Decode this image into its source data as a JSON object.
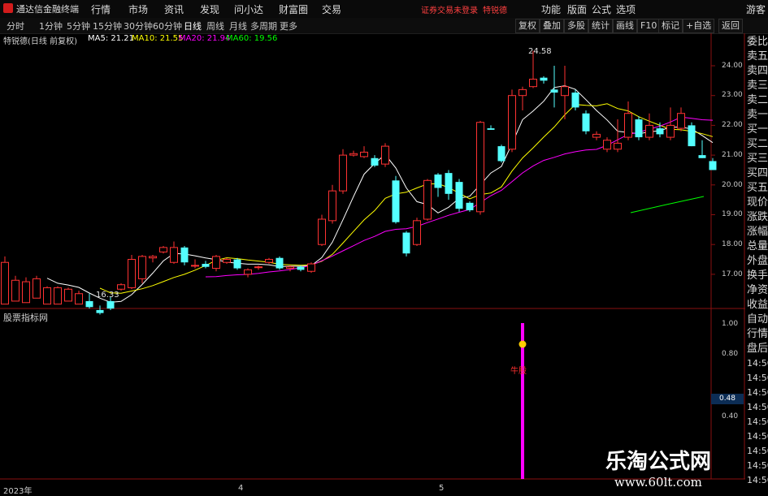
{
  "titlebar": {
    "app": "通达信金融终端",
    "menus": [
      "行情",
      "市场",
      "资讯",
      "发现",
      "问小达",
      "财富圈",
      "交易"
    ],
    "warning": "证券交易未登录",
    "user": "特锐德",
    "right": [
      "功能",
      "版面",
      "公式",
      "选项"
    ],
    "right2": "游客"
  },
  "periods": [
    "分时",
    "1分钟",
    "5分钟",
    "15分钟",
    "30分钟",
    "60分钟",
    "日线",
    "周线",
    "月线",
    "多周期",
    "更多"
  ],
  "active_period": "日线",
  "tools": [
    "复权",
    "叠加",
    "多股",
    "统计",
    "画线",
    "F10",
    "标记",
    "+自选",
    "返回"
  ],
  "stock": {
    "name": "特锐德(日线 前复权)",
    "ma5": "MA5: 21.21",
    "ma10": "MA10: 21.55",
    "ma20": "MA20: 21.94",
    "ma60": "MA60: 19.56"
  },
  "quote_labels": [
    "委比",
    "卖五",
    "卖四",
    "卖三",
    "卖二",
    "卖一",
    "买一",
    "买二",
    "买三",
    "买四",
    "买五",
    "现价",
    "涨跌",
    "涨幅",
    "总量",
    "外盘",
    "换手",
    "净资",
    "收益"
  ],
  "side_labels": [
    "自动",
    "行情",
    "盘后",
    "14:50",
    "14:50",
    "14:50",
    "14:50",
    "14:50",
    "14:50",
    "14:50",
    "14:50",
    "14:50"
  ],
  "price_ticks": [
    "24.00",
    "23.00",
    "22.00",
    "21.00",
    "20.00",
    "19.00",
    "18.00",
    "17.00"
  ],
  "sub_ticks": [
    "1.00",
    "0.80",
    "0.48",
    "0.40"
  ],
  "sub_current": "0.48",
  "indicator_name": "股票指标网",
  "signal_label": "牛股",
  "high_label": "24.58",
  "low_label": "16.33",
  "x_labels": [
    "2023年",
    "4",
    "5"
  ],
  "watermark": "乐淘公式网",
  "watermark_url": "www.60lt.com",
  "colors": {
    "up": "#ff3232",
    "down": "#54ffff",
    "ma5": "#ffffff",
    "ma10": "#ffff00",
    "ma20": "#ff00ff",
    "ma60": "#00ff00",
    "signal": "#ff00ff"
  },
  "candles": [
    [
      16.0,
      17.4,
      17.6,
      16.9
    ],
    [
      16.1,
      16.8,
      16.95,
      16.7
    ],
    [
      16.05,
      16.75,
      16.9,
      16.65
    ],
    [
      16.2,
      16.85,
      16.95,
      16.5
    ],
    [
      16.0,
      16.55,
      16.6,
      16.45
    ],
    [
      16.0,
      16.55,
      16.6,
      16.45
    ],
    [
      16.1,
      16.5,
      16.55,
      16.35
    ],
    [
      16.0,
      16.35,
      16.45,
      16.1
    ],
    [
      16.1,
      15.9,
      16.35,
      15.85
    ],
    [
      15.8,
      15.7,
      15.95,
      15.65
    ],
    [
      16.1,
      15.85,
      16.25,
      15.8
    ],
    [
      16.5,
      16.65,
      16.7,
      16.45
    ],
    [
      16.55,
      17.5,
      17.65,
      16.5
    ],
    [
      16.85,
      17.6,
      17.65,
      16.7
    ],
    [
      17.55,
      17.6,
      17.65,
      17.4
    ],
    [
      17.75,
      17.9,
      17.95,
      17.7
    ],
    [
      17.4,
      17.9,
      18.1,
      17.35
    ],
    [
      17.9,
      17.4,
      17.95,
      17.3
    ],
    [
      17.3,
      17.3,
      17.5,
      17.2
    ],
    [
      17.35,
      17.25,
      17.45,
      17.2
    ],
    [
      17.2,
      17.6,
      17.65,
      17.1
    ],
    [
      17.4,
      17.5,
      17.55,
      17.35
    ],
    [
      17.5,
      17.2,
      17.55,
      17.15
    ],
    [
      17.0,
      17.15,
      17.2,
      16.9
    ],
    [
      17.25,
      17.25,
      17.3,
      17.15
    ],
    [
      17.4,
      17.5,
      17.55,
      17.35
    ],
    [
      17.55,
      17.2,
      17.6,
      17.15
    ],
    [
      17.2,
      17.25,
      17.3,
      17.1
    ],
    [
      17.25,
      17.15,
      17.3,
      17.1
    ],
    [
      17.1,
      17.35,
      17.4,
      17.05
    ],
    [
      18.0,
      18.85,
      19.0,
      17.95
    ],
    [
      18.8,
      19.8,
      20.0,
      18.7
    ],
    [
      19.8,
      21.0,
      21.2,
      19.7
    ],
    [
      21.0,
      21.05,
      21.15,
      20.95
    ],
    [
      20.95,
      21.1,
      21.3,
      20.9
    ],
    [
      20.9,
      20.65,
      21.0,
      20.6
    ],
    [
      20.7,
      21.3,
      21.4,
      20.6
    ],
    [
      20.15,
      18.75,
      20.3,
      18.7
    ],
    [
      18.4,
      17.7,
      18.45,
      17.6
    ],
    [
      18.0,
      18.8,
      18.9,
      17.95
    ],
    [
      18.85,
      20.15,
      20.2,
      18.8
    ],
    [
      20.35,
      19.9,
      20.4,
      19.6
    ],
    [
      20.4,
      19.7,
      20.5,
      19.5
    ],
    [
      20.1,
      19.2,
      20.2,
      19.1
    ],
    [
      19.4,
      19.15,
      19.45,
      19.1
    ],
    [
      19.1,
      22.1,
      22.15,
      19.0
    ],
    [
      21.9,
      21.85,
      22.0,
      21.85
    ],
    [
      21.3,
      20.8,
      21.35,
      20.75
    ],
    [
      21.2,
      23.0,
      23.2,
      21.1
    ],
    [
      23.0,
      23.2,
      23.3,
      22.5
    ],
    [
      23.3,
      23.55,
      24.5,
      23.25
    ],
    [
      23.6,
      23.5,
      23.65,
      23.4
    ],
    [
      23.2,
      23.1,
      24.0,
      22.6
    ],
    [
      23.0,
      23.3,
      24.0,
      22.2
    ],
    [
      23.1,
      22.6,
      23.2,
      22.5
    ],
    [
      22.4,
      21.8,
      22.5,
      21.7
    ],
    [
      21.6,
      21.7,
      21.8,
      21.5
    ],
    [
      21.2,
      21.5,
      21.6,
      21.1
    ],
    [
      21.2,
      21.4,
      22.2,
      21.1
    ],
    [
      21.6,
      22.4,
      22.8,
      21.5
    ],
    [
      22.2,
      21.6,
      22.3,
      21.5
    ],
    [
      21.6,
      22.0,
      22.4,
      21.5
    ],
    [
      21.9,
      21.7,
      22.1,
      21.6
    ],
    [
      21.6,
      22.0,
      22.6,
      21.5
    ],
    [
      21.9,
      22.4,
      22.6,
      21.8
    ],
    [
      22.0,
      21.3,
      22.1,
      21.3
    ],
    [
      21.0,
      20.9,
      21.5,
      20.9
    ],
    [
      20.8,
      20.5,
      20.9,
      20.5
    ]
  ],
  "signal_index": 49
}
